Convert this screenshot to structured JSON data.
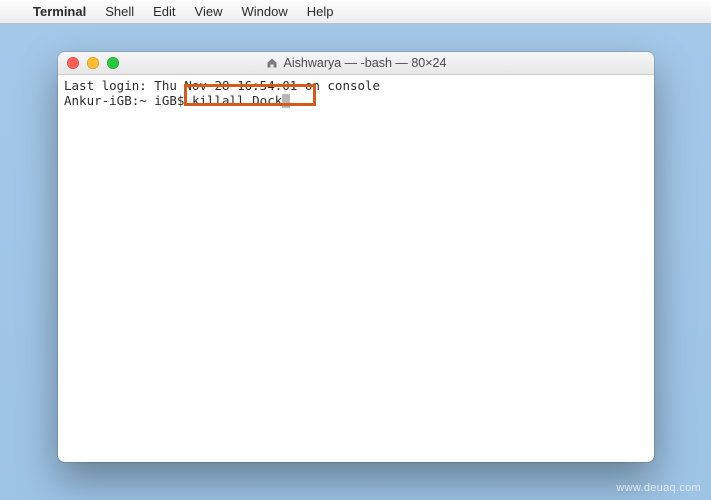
{
  "menubar": {
    "apple": "",
    "appname": "Terminal",
    "items": [
      "Shell",
      "Edit",
      "View",
      "Window",
      "Help"
    ]
  },
  "window": {
    "title": "Aishwarya — -bash — 80×24",
    "traffic": {
      "close": "close",
      "minimize": "minimize",
      "zoom": "zoom"
    }
  },
  "terminal": {
    "line1": "Last login: Thu Nov 28 16:54:01 on console",
    "prompt": "Ankur-iGB:~ iGB$ ",
    "command": "killall Dock"
  },
  "annotation": {
    "highlight_target": "command"
  },
  "watermark": "www.deuaq.com"
}
